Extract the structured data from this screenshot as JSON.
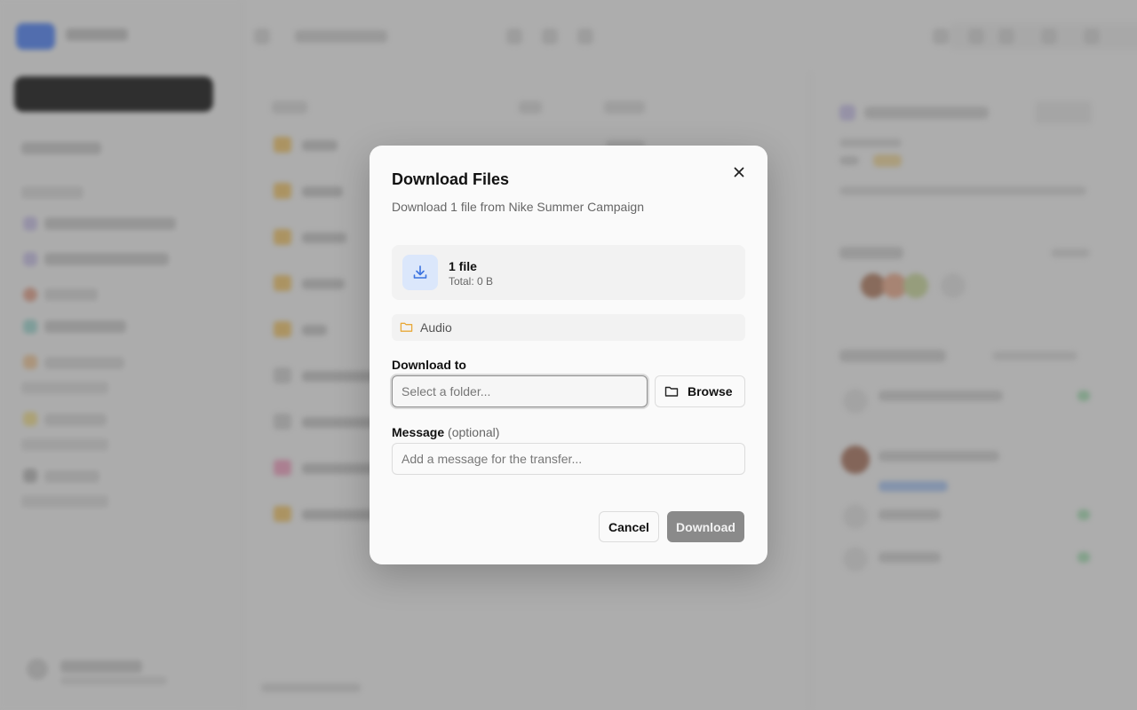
{
  "dialog": {
    "title": "Download Files",
    "subtitle": "Download 1 file from Nike Summer Campaign",
    "file_summary": {
      "count_label": "1 file",
      "total_label": "Total: 0 B"
    },
    "folders": [
      "Audio"
    ],
    "download_to": {
      "label": "Download to",
      "placeholder": "Select a folder...",
      "value": "",
      "browse_label": "Browse"
    },
    "message": {
      "label": "Message",
      "optional_hint": "(optional)",
      "placeholder": "Add a message for the transfer...",
      "value": ""
    },
    "cancel_label": "Cancel",
    "download_label": "Download",
    "download_enabled": false
  },
  "icons": {
    "close": "close-icon",
    "download": "download-icon",
    "folder": "folder-icon",
    "browse": "folder-open-icon"
  },
  "colors": {
    "accent_light": "#dbe7fb",
    "accent": "#3b73e0",
    "folder": "#e8a93a",
    "disabled_button": "#8a8a8a"
  }
}
